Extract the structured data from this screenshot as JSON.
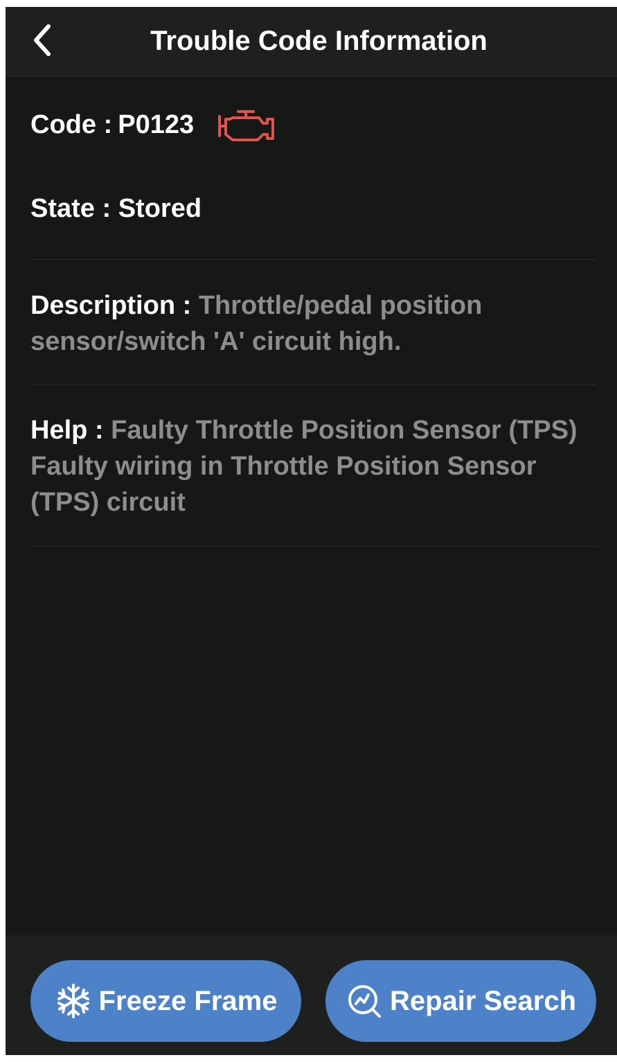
{
  "header": {
    "title": "Trouble Code Information",
    "back_icon": "chevron-left-icon"
  },
  "code": {
    "label": "Code :",
    "value": "P0123",
    "icon": "check-engine-icon",
    "icon_color": "#e3524c"
  },
  "state": {
    "label": "State :",
    "value": "Stored"
  },
  "description": {
    "label": "Description :",
    "value": "Throttle/pedal position sensor/switch 'A' circuit high."
  },
  "help": {
    "label": "Help :",
    "value": "Faulty Throttle Position Sensor (TPS) Faulty wiring in Throttle Position Sensor (TPS) circuit"
  },
  "actions": {
    "freeze_frame": {
      "label": "Freeze Frame",
      "icon": "snowflake-icon"
    },
    "repair_search": {
      "label": "Repair Search",
      "icon": "search-chart-icon"
    }
  },
  "colors": {
    "background": "#151815",
    "bar": "#1e201e",
    "button": "#4d82c9",
    "muted_text": "#8c8e8c"
  }
}
